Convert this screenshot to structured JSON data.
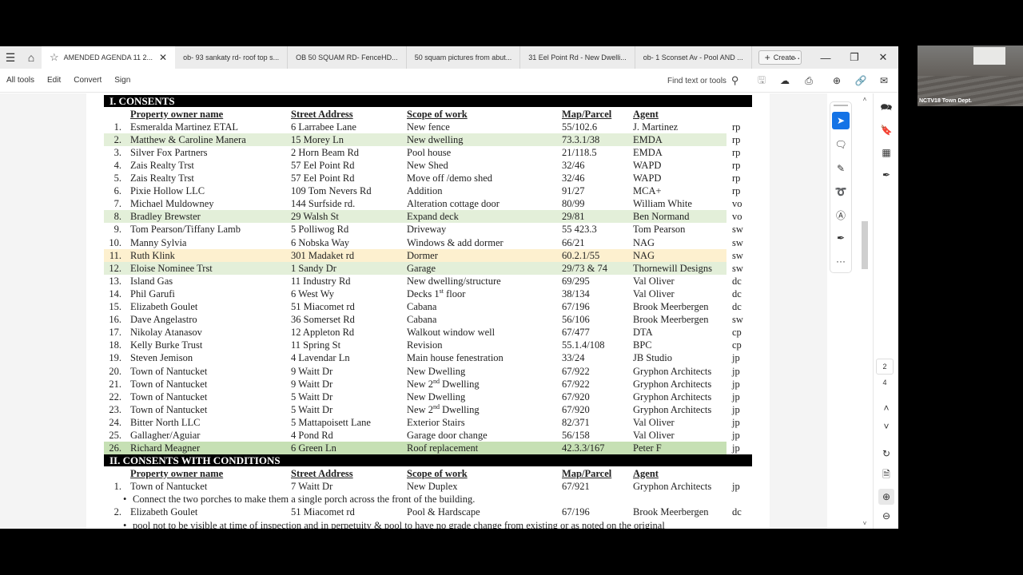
{
  "tabs": [
    {
      "label": "AMENDED AGENDA 11 2...",
      "active": true
    },
    {
      "label": "ob- 93 sankaty rd- roof top s..."
    },
    {
      "label": "OB 50 SQUAM RD- FenceHD..."
    },
    {
      "label": "50 squam pictures from abut..."
    },
    {
      "label": "31 Eel Point Rd - New Dwelli..."
    },
    {
      "label": "ob- 1 Sconset Av - Pool AND ..."
    }
  ],
  "create_label": "Create",
  "menu": [
    "All tools",
    "Edit",
    "Convert",
    "Sign"
  ],
  "find_label": "Find text or tools",
  "pagination": {
    "current": "2",
    "total": "4"
  },
  "webcam_caption": "NCTV18 Town Dept.",
  "document": {
    "section1": {
      "title": "I. CONSENTS",
      "headers": {
        "owner": "Property owner name",
        "address": "Street Address",
        "scope": "Scope of work",
        "map": "Map/Parcel",
        "agent": "Agent"
      },
      "rows": [
        {
          "num": "1.",
          "owner": "Esmeralda Martinez ETAL",
          "address": "6 Larrabee Lane",
          "scope": "New fence",
          "map": "55/102.6",
          "agent": "J. Martinez",
          "init": "rp",
          "hl": ""
        },
        {
          "num": "2.",
          "owner": "Matthew & Caroline Manera",
          "address": "15 Morey Ln",
          "scope": "New dwelling",
          "map": "73.3.1/38",
          "agent": "EMDA",
          "init": "rp",
          "hl": "green"
        },
        {
          "num": "3.",
          "owner": "Silver Fox Partners",
          "address": "2 Horn Beam Rd",
          "scope": "Pool house",
          "map": "21/118.5",
          "agent": "EMDA",
          "init": "rp",
          "hl": ""
        },
        {
          "num": "4.",
          "owner": "Zais Realty Trst",
          "address": "57 Eel Point Rd",
          "scope": "New Shed",
          "map": "32/46",
          "agent": "WAPD",
          "init": "rp",
          "hl": ""
        },
        {
          "num": "5.",
          "owner": "Zais Realty Trst",
          "address": "57 Eel Point Rd",
          "scope": "Move off /demo shed",
          "map": "32/46",
          "agent": "WAPD",
          "init": "rp",
          "hl": ""
        },
        {
          "num": "6.",
          "owner": "Pixie Hollow LLC",
          "address": "109 Tom Nevers Rd",
          "scope": "Addition",
          "map": "91/27",
          "agent": "MCA+",
          "init": "rp",
          "hl": ""
        },
        {
          "num": "7.",
          "owner": "Michael Muldowney",
          "address": "144 Surfside rd.",
          "scope": "Alteration cottage door",
          "map": "80/99",
          "agent": "William White",
          "init": "vo",
          "hl": ""
        },
        {
          "num": "8.",
          "owner": "Bradley Brewster",
          "address": "29 Walsh St",
          "scope": "Expand deck",
          "map": "29/81",
          "agent": "Ben Normand",
          "init": "vo",
          "hl": "green"
        },
        {
          "num": "9.",
          "owner": "Tom Pearson/Tiffany Lamb",
          "address": "5 Polliwog Rd",
          "scope": "Driveway",
          "map": "55 423.3",
          "agent": "Tom Pearson",
          "init": "sw",
          "hl": ""
        },
        {
          "num": "10.",
          "owner": "Manny Sylvia",
          "address": "6 Nobska Way",
          "scope": "Windows & add dormer",
          "map": "66/21",
          "agent": "NAG",
          "init": "sw",
          "hl": ""
        },
        {
          "num": "11.",
          "owner": "Ruth Klink",
          "address": "301 Madaket rd",
          "scope": "Dormer",
          "map": "60.2.1/55",
          "agent": "NAG",
          "init": "sw",
          "hl": "yellow"
        },
        {
          "num": "12.",
          "owner": "Eloise Nominee Trst",
          "address": "1 Sandy Dr",
          "scope": "Garage",
          "map": "29/73 & 74",
          "agent": "Thornewill Designs",
          "init": "sw",
          "hl": "green"
        },
        {
          "num": "13.",
          "owner": "Island Gas",
          "address": "11 Industry Rd",
          "scope": "New dwelling/structure",
          "map": "69/295",
          "agent": "Val Oliver",
          "init": "dc",
          "hl": ""
        },
        {
          "num": "14.",
          "owner": "Phil Garufi",
          "address": "6 West Wy",
          "scope": "Decks 1|st| floor",
          "map": "38/134",
          "agent": "Val Oliver",
          "init": "dc",
          "hl": ""
        },
        {
          "num": "15.",
          "owner": "Elizabeth Goulet",
          "address": "51 Miacomet rd",
          "scope": "Cabana",
          "map": "67/196",
          "agent": "Brook Meerbergen",
          "init": "dc",
          "hl": ""
        },
        {
          "num": "16.",
          "owner": "Dave Angelastro",
          "address": "36 Somerset Rd",
          "scope": "Cabana",
          "map": "56/106",
          "agent": "Brook Meerbergen",
          "init": "sw",
          "hl": ""
        },
        {
          "num": "17.",
          "owner": "Nikolay Atanasov",
          "address": "12 Appleton Rd",
          "scope": "Walkout window well",
          "map": "67/477",
          "agent": "DTA",
          "init": "cp",
          "hl": ""
        },
        {
          "num": "18.",
          "owner": "Kelly Burke Trust",
          "address": "11 Spring St",
          "scope": "Revision",
          "map": "55.1.4/108",
          "agent": "BPC",
          "init": "cp",
          "hl": ""
        },
        {
          "num": "19.",
          "owner": "Steven Jemison",
          "address": "4 Lavendar Ln",
          "scope": "Main house fenestration",
          "map": "33/24",
          "agent": "JB Studio",
          "init": "jp",
          "hl": ""
        },
        {
          "num": "20.",
          "owner": "Town of Nantucket",
          "address": "9 Waitt Dr",
          "scope": "New Dwelling",
          "map": "67/922",
          "agent": "Gryphon Architects",
          "init": "jp",
          "hl": ""
        },
        {
          "num": "21.",
          "owner": "Town of Nantucket",
          "address": "9 Waitt Dr",
          "scope": "New 2|nd| Dwelling",
          "map": "67/922",
          "agent": "Gryphon Architects",
          "init": "jp",
          "hl": ""
        },
        {
          "num": "22.",
          "owner": "Town of Nantucket",
          "address": "5 Waitt Dr",
          "scope": "New Dwelling",
          "map": "67/920",
          "agent": "Gryphon Architects",
          "init": "jp",
          "hl": ""
        },
        {
          "num": "23.",
          "owner": "Town of Nantucket",
          "address": "5 Waitt Dr",
          "scope": "New 2|nd| Dwelling",
          "map": "67/920",
          "agent": "Gryphon Architects",
          "init": "jp",
          "hl": ""
        },
        {
          "num": "24.",
          "owner": "Bitter North LLC",
          "address": "5 Mattapoisett Lane",
          "scope": "Exterior Stairs",
          "map": "82/371",
          "agent": "Val Oliver",
          "init": "jp",
          "hl": ""
        },
        {
          "num": "25.",
          "owner": "Gallagher/Aguiar",
          "address": "4 Pond Rd",
          "scope": "Garage door change",
          "map": "56/158",
          "agent": "Val Oliver",
          "init": "jp",
          "hl": ""
        },
        {
          "num": "26.",
          "owner": "Richard Meagner",
          "address": "6 Green Ln",
          "scope": "Roof replacement",
          "map": "42.3.3/167",
          "agent": "Peter F",
          "init": "jp",
          "hl": "dgreen"
        }
      ]
    },
    "section2": {
      "title": "II. CONSENTS WITH CONDITIONS",
      "headers": {
        "owner": "Property owner name",
        "address": "Street Address",
        "scope": "Scope of work",
        "map": "Map/Parcel",
        "agent": "Agent"
      },
      "rows": [
        {
          "num": "1.",
          "owner": "Town of Nantucket",
          "address": "7 Waitt Dr",
          "scope": "New Duplex",
          "map": "67/921",
          "agent": "Gryphon Architects",
          "init": "jp",
          "note": "Connect the two porches to make them a single porch across the front of the building."
        },
        {
          "num": "2.",
          "owner": "Elizabeth Goulet",
          "address": "51 Miacomet rd",
          "scope": "Pool & Hardscape",
          "map": "67/196",
          "agent": "Brook Meerbergen",
          "init": "dc",
          "note": "pool not to be visible at time of inspection and in perpetuity & pool to have no grade change from existing or as noted on the original"
        }
      ]
    }
  }
}
